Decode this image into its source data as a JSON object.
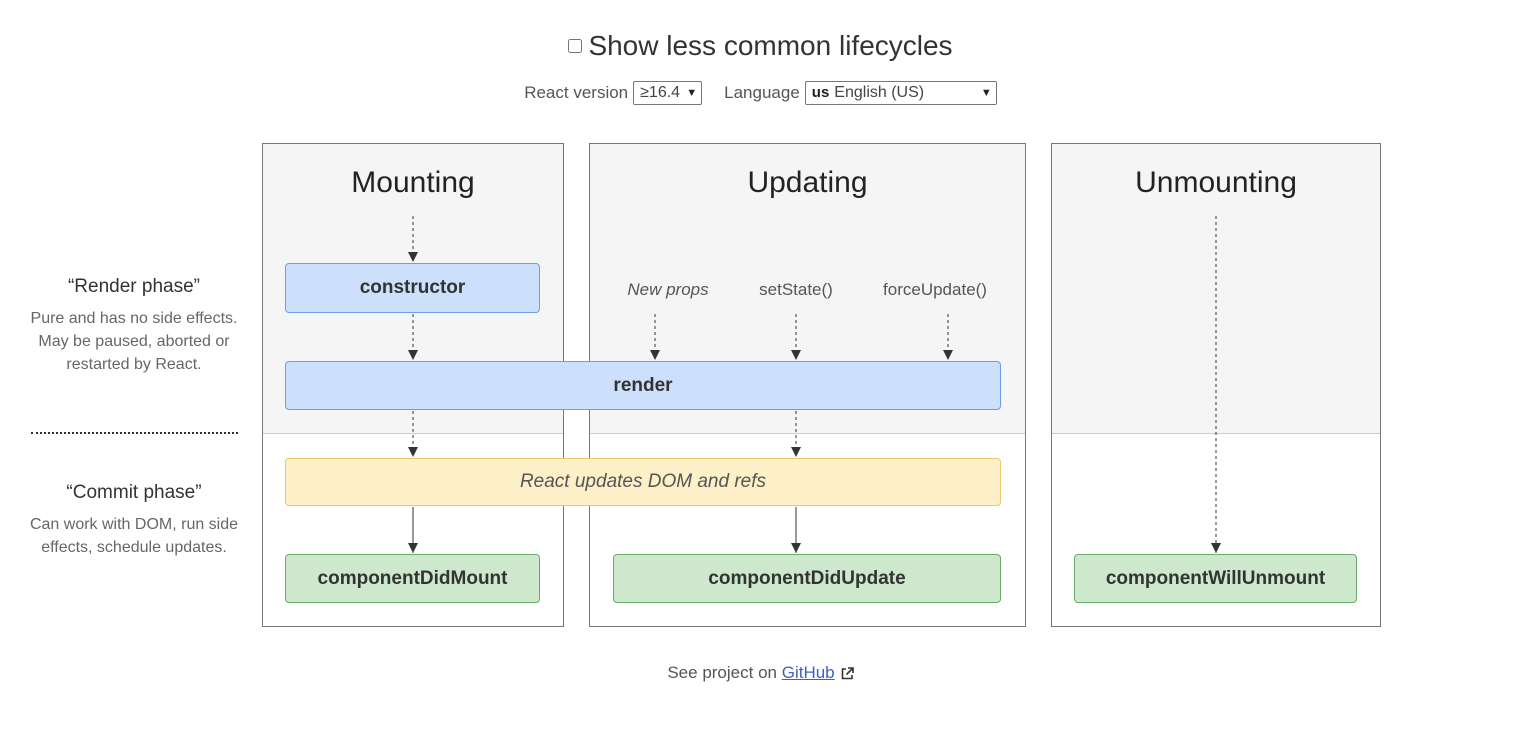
{
  "header": {
    "title": "Show less common lifecycles",
    "react_version_label": "React version",
    "react_version_value": "≥16.4",
    "language_label": "Language",
    "language_flag": "us",
    "language_value": "English (US)"
  },
  "phases": {
    "render": {
      "title": "“Render phase”",
      "description": "Pure and has no side effects. May be paused, aborted or restarted by React."
    },
    "commit": {
      "title": "“Commit phase”",
      "description": "Can work with DOM, run side effects, schedule updates."
    }
  },
  "panels": {
    "mounting": "Mounting",
    "updating": "Updating",
    "unmounting": "Unmounting"
  },
  "triggers": {
    "new_props": "New props",
    "set_state": "setState()",
    "force_update": "forceUpdate()"
  },
  "nodes": {
    "constructor": "constructor",
    "render": "render",
    "react_updates": "React updates DOM and refs",
    "component_did_mount": "componentDidMount",
    "component_did_update": "componentDidUpdate",
    "component_will_unmount": "componentWillUnmount"
  },
  "footer": {
    "prefix": "See project on",
    "link": "GitHub"
  },
  "colors": {
    "render_phase_box": "#cce0fb",
    "commit_dom_box": "#fdf0c8",
    "commit_method_box": "#cde8cd"
  }
}
